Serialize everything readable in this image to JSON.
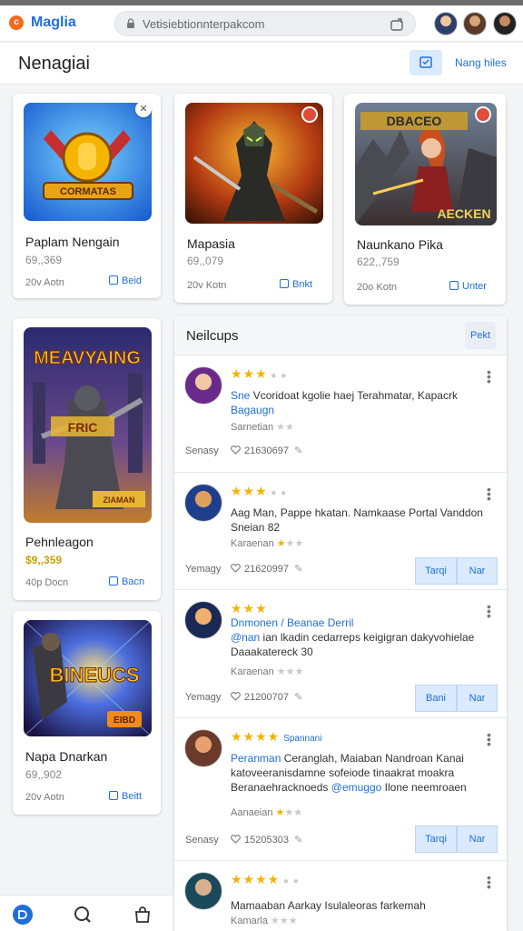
{
  "app": {
    "name": "Maglia",
    "url": "Vetisiebtionnterpakcom"
  },
  "header": {
    "title": "Nenagiai",
    "link": "Nang hiles"
  },
  "products": [
    {
      "title": "Paplam Nengain",
      "price": "69,,369",
      "meta": "20v Aotn",
      "action": "Beid"
    },
    {
      "title": "Mapasia",
      "price": "69,,079",
      "meta": "20v Kotn",
      "action": "Bnkt"
    },
    {
      "title": "Naunkano Pika",
      "price": "622,,759",
      "meta": "20o Kotn",
      "action": "Unter"
    },
    {
      "title": "Pehnleagon",
      "price": "$9,,359",
      "meta": "40p Docn",
      "action": "Bacn"
    },
    {
      "title": "Napa Dnarkan",
      "price": "69,,902",
      "meta": "20v Aotn",
      "action": "Beitt"
    }
  ],
  "thumb_text": {
    "t1": "CORMATAS",
    "t2": "DBACEO",
    "t2b": "AECKEN",
    "t3": "MEAVYAING",
    "t3b": "FRIC",
    "t3c": "ZIAMAN",
    "t4": "BINEUCS",
    "t4b": "EIBD"
  },
  "reviews_panel": {
    "title": "Neilcups",
    "button": "Pekt",
    "reviews": [
      {
        "stars_tag": "",
        "text_hl": "Sne",
        "text": "Vcoridoat kgolie haej Terahmatar, Kapacrk",
        "text2_hl": "Bagaugn",
        "text2": "",
        "sub": "Sarnetian",
        "date": "Senasy",
        "likes": "21630697",
        "btn1": "",
        "btn2": ""
      },
      {
        "stars_tag": "",
        "text_hl": "",
        "text": "Aag Man, Pappe hkatan. Namkaase Portal Vanddon Sneian 82",
        "text2_hl": "",
        "text2": "",
        "sub": "Karaenan",
        "date": "Yemagy",
        "likes": "21620997",
        "btn1": "Tarqi",
        "btn2": "Nar"
      },
      {
        "stars_tag": "/ Beanae Derril",
        "text_hl": "Dnmonen",
        "text": "",
        "text2_hl": "@nan",
        "text2": "ian lkadin cedarreps keigigran dakyvohielae Daaakatereck 30",
        "sub": "Karaenan",
        "date": "Yemagy",
        "likes": "21200707",
        "btn1": "Bani",
        "btn2": "Nar"
      },
      {
        "stars_tag": "Spannani",
        "text_hl": "Peranman",
        "text": "Ceranglah, Maiaban Nandroan Kanai katoveeranisdamne sofeiode tinaakrat moakra Beranaehracknoeds",
        "text2_hl": "@emuggo",
        "text2": "Ilone neemroaen",
        "sub": "Aanaeian",
        "date": "Senasy",
        "likes": "15205303",
        "btn1": "Tarqi",
        "btn2": "Nar"
      },
      {
        "stars_tag": "",
        "text_hl": "",
        "text": "Mamaaban Aarkay Isulaleoras farkemah",
        "text2_hl": "",
        "text2": "",
        "sub": "Kamarla",
        "date": "",
        "likes": "",
        "btn1": "",
        "btn2": ""
      }
    ]
  },
  "colors": {
    "accent": "#1e6fd9",
    "star": "#f5b301",
    "brand": "#f26b1d"
  },
  "icons": {
    "brand": "maglia-logo-icon",
    "lock": "lock-icon",
    "url_action": "share-icon",
    "head": "calendar-icon",
    "like": "heart-icon",
    "pin": "pin-icon",
    "nav": [
      "home-icon",
      "search-icon",
      "bag-icon"
    ]
  }
}
